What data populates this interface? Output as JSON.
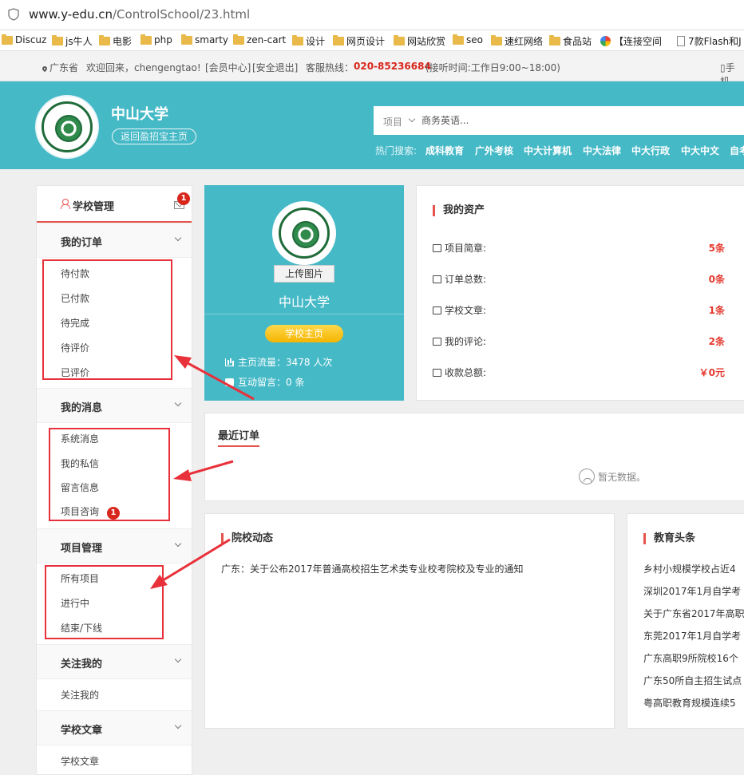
{
  "browser": {
    "url_host": "www.y-edu.cn",
    "url_path": "/ControlSchool/23.html",
    "bookmarks": [
      {
        "label": "Discuz",
        "type": "folder"
      },
      {
        "label": "js牛人",
        "type": "folder"
      },
      {
        "label": "电影",
        "type": "folder"
      },
      {
        "label": "php",
        "type": "folder"
      },
      {
        "label": "smarty",
        "type": "folder"
      },
      {
        "label": "zen-cart",
        "type": "folder"
      },
      {
        "label": "设计",
        "type": "folder"
      },
      {
        "label": "网页设计",
        "type": "folder"
      },
      {
        "label": "网站欣赏",
        "type": "folder"
      },
      {
        "label": "seo",
        "type": "folder"
      },
      {
        "label": "速红网络",
        "type": "folder"
      },
      {
        "label": "食品站",
        "type": "folder"
      },
      {
        "label": "【连接空间",
        "type": "site"
      },
      {
        "label": "7款Flash和J",
        "type": "page"
      }
    ]
  },
  "topbar": {
    "location": "广东省",
    "welcome": "欢迎回来，chengengtao!",
    "member_center": "[会员中心]",
    "logout": "[安全退出]",
    "hotline_label": "客服热线：",
    "hotline": "020-85236684",
    "hours": "(接听时间:工作日9:00~18:00)",
    "mobile": "手机"
  },
  "header": {
    "school_name": "中山大学",
    "back_link": "返回盈招宝主页",
    "search_select": "项目",
    "search_placeholder": "商务英语...",
    "hot_label": "热门搜索:",
    "hot_terms": [
      "成科教育",
      "广外考核",
      "中大计算机",
      "中大法律",
      "中大行政",
      "中大中文",
      "自考"
    ]
  },
  "sidebar": {
    "head_title": "学校管理",
    "mail_badge": "1",
    "sections": [
      {
        "title": "我的订单",
        "items": [
          "待付款",
          "已付款",
          "待完成",
          "待评价",
          "已评价"
        ]
      },
      {
        "title": "我的消息",
        "items": [
          "系统消息",
          "我的私信",
          "留言信息",
          "项目咨询"
        ],
        "badge": "1"
      },
      {
        "title": "项目管理",
        "items": [
          "所有项目",
          "进行中",
          "结束/下线"
        ]
      },
      {
        "title": "关注我的",
        "items": [
          "关注我的"
        ]
      },
      {
        "title": "学校文章",
        "items": [
          "学校文章"
        ]
      }
    ]
  },
  "profile": {
    "upload_label": "上传图片",
    "name": "中山大学",
    "home_button": "学校主页",
    "traffic": "主页流量：3478 人次",
    "messages": "互动留言：0 条"
  },
  "assets": {
    "title": "我的资产",
    "rows": [
      {
        "label": "项目简章:",
        "value": "5条"
      },
      {
        "label": "订单总数:",
        "value": "0条"
      },
      {
        "label": "学校文章:",
        "value": "1条"
      },
      {
        "label": "我的评论:",
        "value": "2条"
      },
      {
        "label": "收款总额:",
        "value": "￥0元"
      }
    ]
  },
  "orders": {
    "title": "最近订单",
    "empty": "暂无数据。"
  },
  "news_school": {
    "title": "院校动态",
    "items": [
      "广东：关于公布2017年普通高校招生艺术类专业校考院校及专业的通知"
    ]
  },
  "news_edu": {
    "title": "教育头条",
    "items": [
      "乡村小规模学校占近4",
      "深圳2017年1月自学考",
      "关于广东省2017年高职",
      "东莞2017年1月自学考",
      "广东高职9所院校16个",
      "广东50所自主招生试点",
      "粤高职教育规模连续5"
    ]
  },
  "colors": {
    "teal": "#46b9c7",
    "accent_red": "#e5544c",
    "value_red": "#e5392f",
    "annotation_red": "#e8313a"
  }
}
